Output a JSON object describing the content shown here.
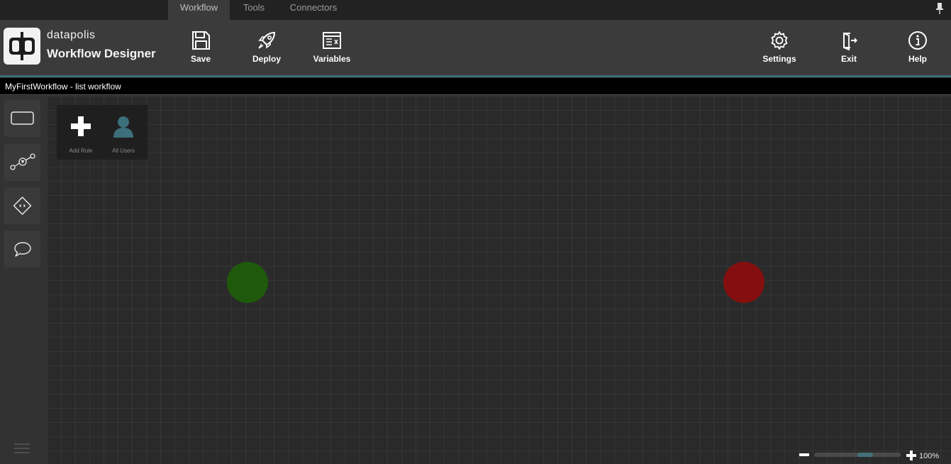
{
  "tabs": [
    {
      "label": "Workflow",
      "active": true
    },
    {
      "label": "Tools",
      "active": false
    },
    {
      "label": "Connectors",
      "active": false
    }
  ],
  "brand": {
    "name": "datapolis",
    "app_title": "Workflow Designer",
    "logo_icon": "datapolis-logo-icon"
  },
  "toolbar": {
    "save_label": "Save",
    "deploy_label": "Deploy",
    "variables_label": "Variables",
    "settings_label": "Settings",
    "exit_label": "Exit",
    "help_label": "Help"
  },
  "document": {
    "title": "MyFirstWorkflow - list workflow"
  },
  "palette": {
    "tools": [
      "task-tool-icon",
      "connector-tool-icon",
      "decision-tool-icon",
      "comment-tool-icon"
    ]
  },
  "roles": {
    "add_role_label": "Add Role",
    "all_users_label": "All Users"
  },
  "nodes": {
    "start_color": "#1f5a0c",
    "end_color": "#850f0f"
  },
  "zoom": {
    "level": "100%",
    "value": 0.5
  },
  "colors": {
    "accent": "#3b6f73",
    "ribbon": "#3b3b3b",
    "canvas": "#2a2a2a"
  }
}
